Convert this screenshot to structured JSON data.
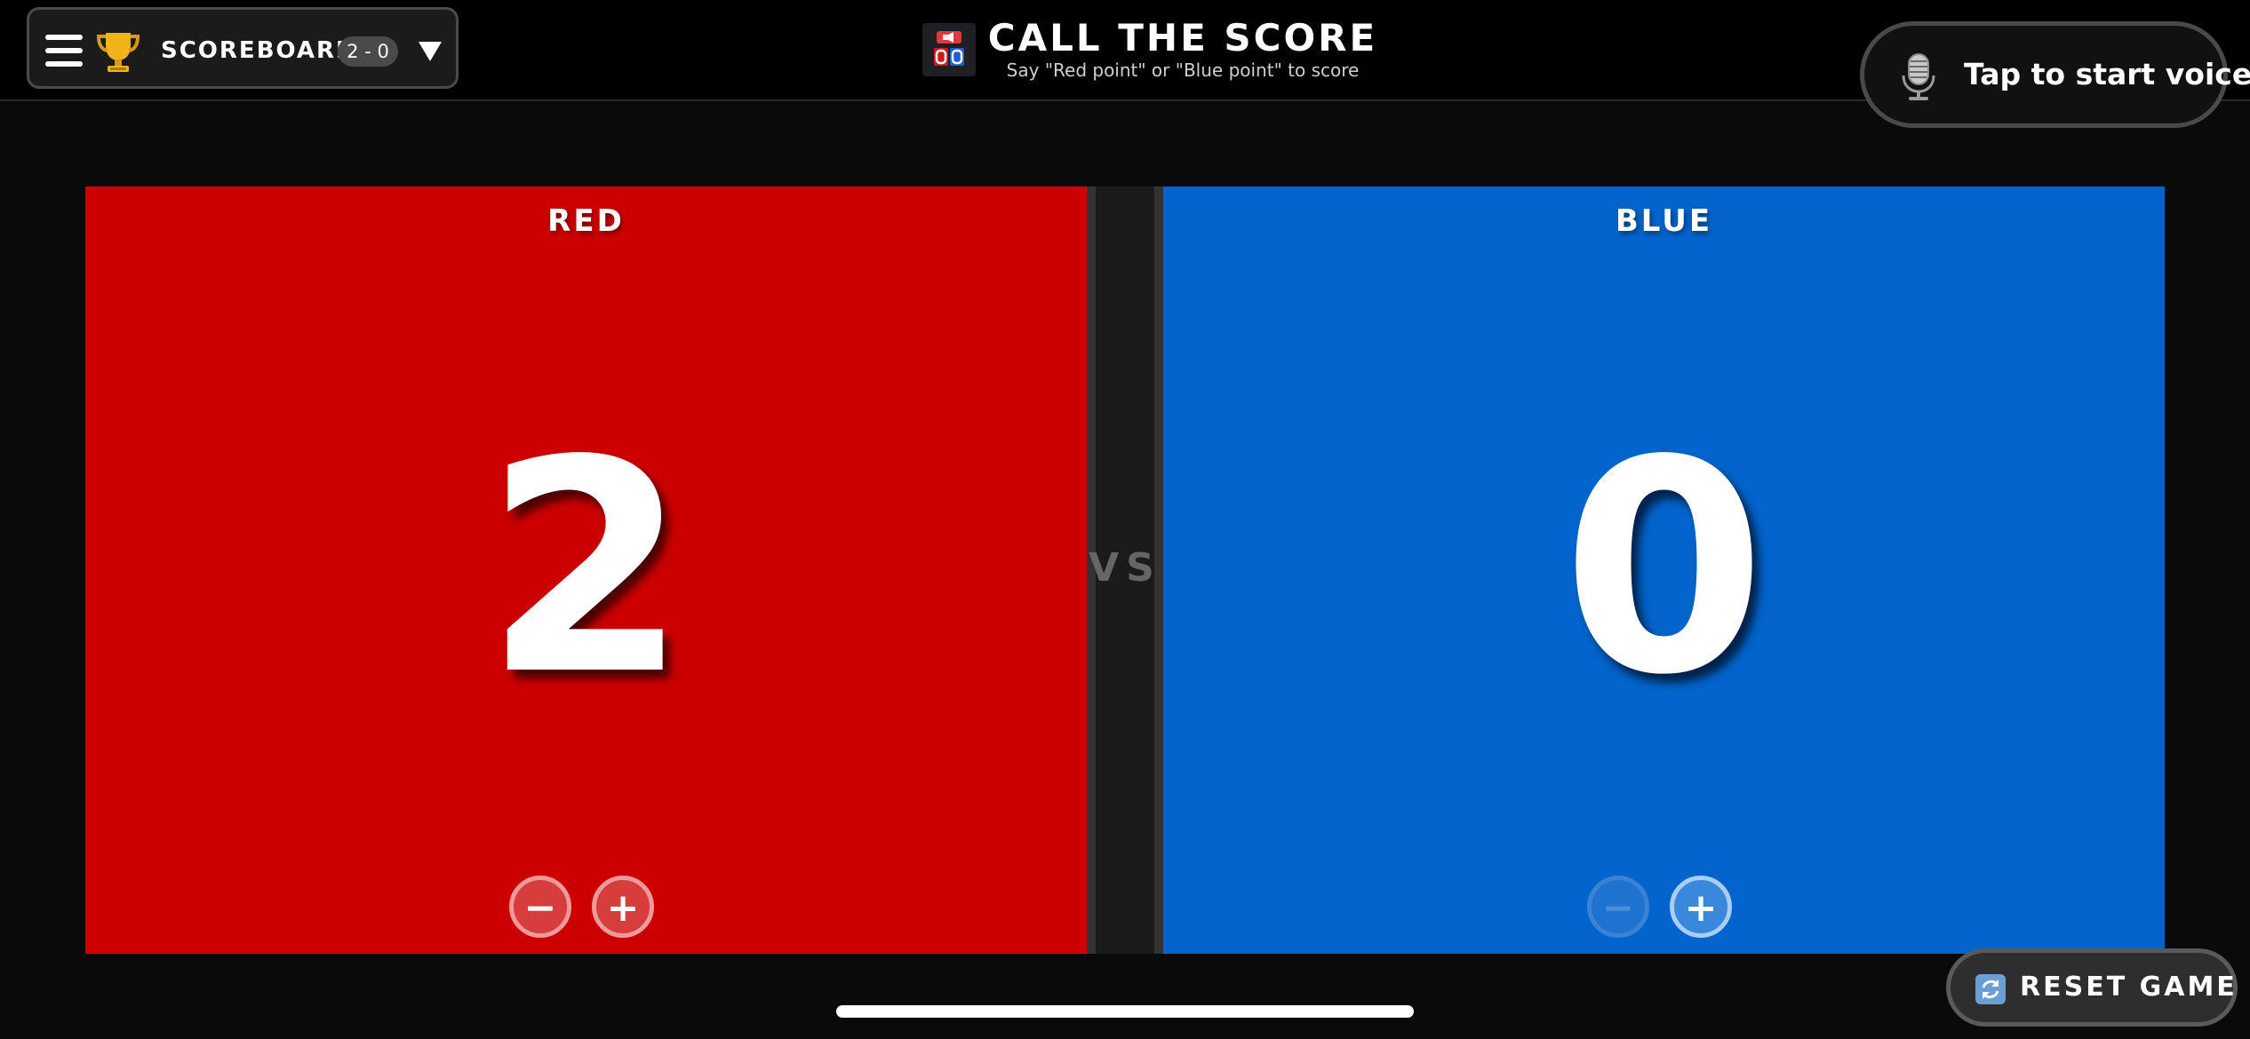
{
  "header": {
    "menu_label": "SCOREBOARD",
    "score_summary": "2 - 0",
    "title": "CALL THE SCORE",
    "subtitle": "Say \"Red point\" or \"Blue point\" to score",
    "voice_button_label": "Tap to start voice"
  },
  "icons": {
    "menu": "hamburger-icon",
    "trophy": "trophy-icon",
    "dropdown": "chevron-down-icon",
    "app": "app-icon",
    "mic": "microphone-icon",
    "reset": "refresh-icon"
  },
  "teams": [
    {
      "name": "RED",
      "score": "2",
      "color": "#cc0000",
      "minus_label": "−",
      "plus_label": "+"
    },
    {
      "name": "BLUE",
      "score": "0",
      "color": "#0264cc",
      "minus_label": "−",
      "plus_label": "+"
    }
  ],
  "divider_label": "VS",
  "footer": {
    "reset_label": "RESET GAME"
  }
}
